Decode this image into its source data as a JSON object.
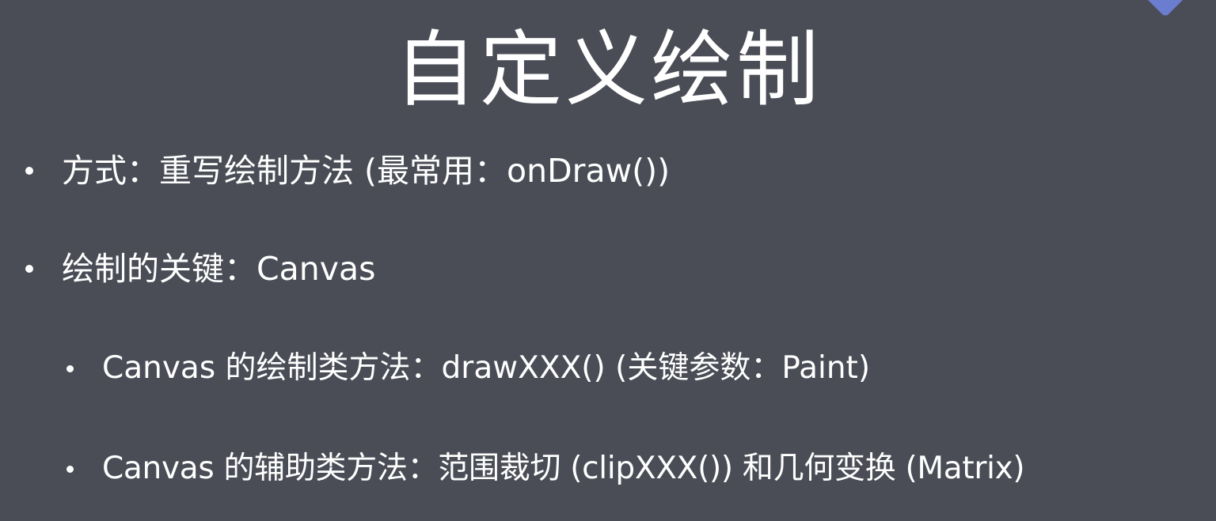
{
  "slide": {
    "title": "自定义绘制",
    "bullets": [
      {
        "text": "方式：重写绘制方法 (最常用：onDraw())"
      },
      {
        "text": "绘制的关键：Canvas"
      }
    ],
    "sub_bullets": [
      {
        "text": "Canvas 的绘制类方法：drawXXX() (关键参数：Paint)"
      },
      {
        "text": "Canvas 的辅助类方法：范围裁切 (clipXXX()) 和几何变换 (Matrix)"
      }
    ]
  },
  "colors": {
    "background": "#4a4d56",
    "text": "#ffffff",
    "corner_accent": "#6b7fd6"
  },
  "icons": {
    "corner_mark": "diamond-mark-icon",
    "bullet": "bullet-dot-icon"
  }
}
